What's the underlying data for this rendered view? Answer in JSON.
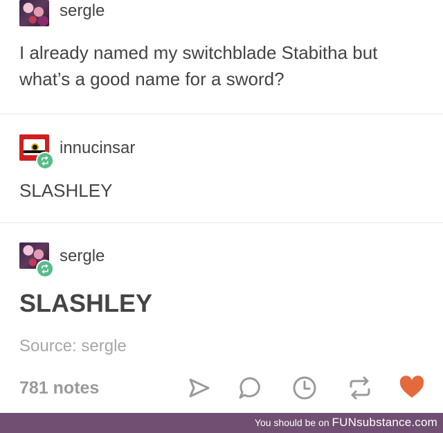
{
  "post": {
    "blocks": [
      {
        "username": "sergle",
        "text": "I already named my switchblade Stabitha but what’s a good name for a sword?"
      },
      {
        "username": "innucinsar",
        "text": "SLASHLEY"
      },
      {
        "username": "sergle",
        "text": "SLASHLEY"
      }
    ],
    "source": "Source: sergle",
    "notes": "781 notes"
  },
  "actions": {
    "icons": [
      "share-icon",
      "reply-icon",
      "queue-clock-icon",
      "reblog-icon",
      "like-heart-icon"
    ]
  },
  "colors": {
    "reblog_badge": "#56bc8a",
    "like_heart": "#e46a3e",
    "footer_bar": "#714f73",
    "text": "#444444",
    "muted": "#9a9a9a"
  },
  "footer": {
    "prefix": "You should be on ",
    "brand_prefix": "FUN",
    "brand_suffix": "substance.com"
  }
}
